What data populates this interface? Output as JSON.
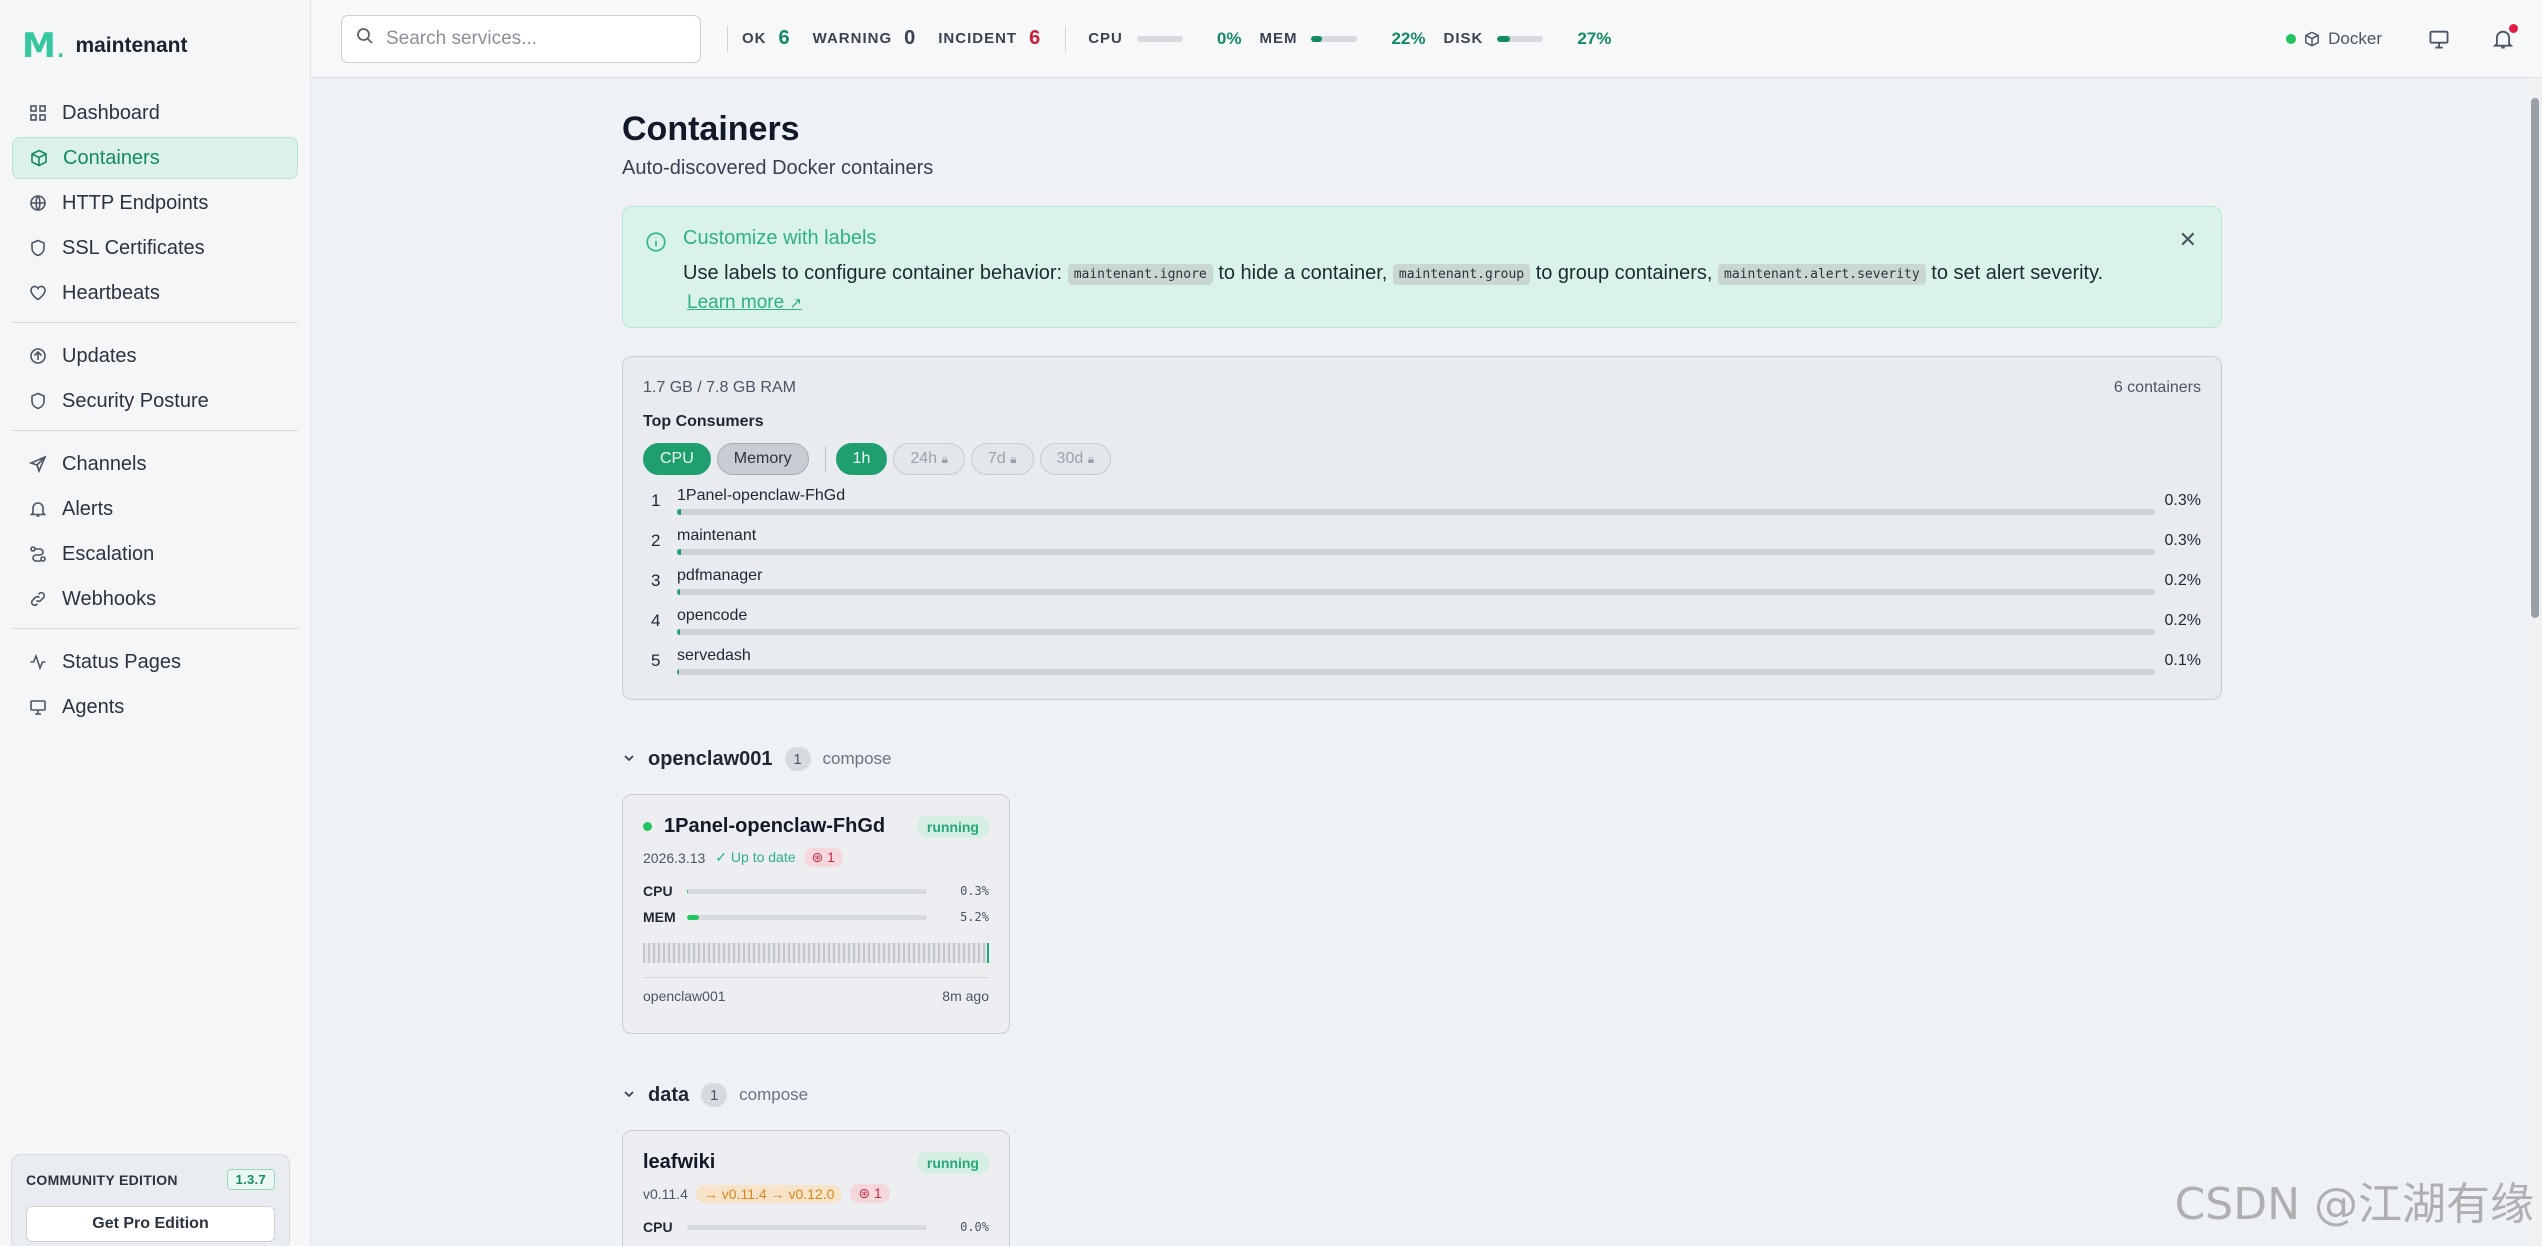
{
  "brand": {
    "name": "maintenant",
    "logo": "M"
  },
  "sidebar": {
    "groups": [
      [
        {
          "label": "Dashboard",
          "icon": "grid-icon"
        },
        {
          "label": "Containers",
          "icon": "box-icon",
          "active": true
        },
        {
          "label": "HTTP Endpoints",
          "icon": "globe-icon"
        },
        {
          "label": "SSL Certificates",
          "icon": "shield-icon"
        },
        {
          "label": "Heartbeats",
          "icon": "heart-icon"
        }
      ],
      [
        {
          "label": "Updates",
          "icon": "arrow-up-circle-icon"
        },
        {
          "label": "Security Posture",
          "icon": "shield-check-icon"
        }
      ],
      [
        {
          "label": "Channels",
          "icon": "send-icon"
        },
        {
          "label": "Alerts",
          "icon": "bell-icon"
        },
        {
          "label": "Escalation",
          "icon": "route-icon"
        },
        {
          "label": "Webhooks",
          "icon": "link-icon"
        }
      ],
      [
        {
          "label": "Status Pages",
          "icon": "activity-icon"
        },
        {
          "label": "Agents",
          "icon": "monitor-icon"
        }
      ]
    ],
    "edition": {
      "label": "COMMUNITY EDITION",
      "version": "1.3.7",
      "button": "Get Pro Edition"
    }
  },
  "topbar": {
    "search_placeholder": "Search services...",
    "ok_label": "OK",
    "ok_count": "6",
    "warning_label": "WARNING",
    "warning_count": "0",
    "incident_label": "INCIDENT",
    "incident_count": "6",
    "cpu_label": "CPU",
    "cpu_pct": "0%",
    "cpu_value": 0,
    "mem_label": "MEM",
    "mem_pct": "22%",
    "mem_value": 22,
    "disk_label": "DISK",
    "disk_pct": "27%",
    "disk_value": 27,
    "runtime": "Docker"
  },
  "page": {
    "title": "Containers",
    "subtitle": "Auto-discovered Docker containers"
  },
  "callout": {
    "title": "Customize with labels",
    "text_1": "Use labels to configure container behavior:",
    "code_1": "maintenant.ignore",
    "text_2": "to hide a container,",
    "code_2": "maintenant.group",
    "text_3": "to group containers,",
    "code_3": "maintenant.alert.severity",
    "text_4": "to set alert severity.",
    "link": "Learn more"
  },
  "consumers": {
    "ram": "1.7 GB / 7.8 GB RAM",
    "count": "6 containers",
    "title": "Top Consumers",
    "metric_tabs": [
      "CPU",
      "Memory"
    ],
    "range_tabs": [
      "1h",
      "24h",
      "7d",
      "30d"
    ],
    "rows": [
      {
        "rank": "1",
        "name": "1Panel-openclaw-FhGd",
        "value": "0.3%",
        "pct": 0.3
      },
      {
        "rank": "2",
        "name": "maintenant",
        "value": "0.3%",
        "pct": 0.3
      },
      {
        "rank": "3",
        "name": "pdfmanager",
        "value": "0.2%",
        "pct": 0.2
      },
      {
        "rank": "4",
        "name": "opencode",
        "value": "0.2%",
        "pct": 0.2
      },
      {
        "rank": "5",
        "name": "servedash",
        "value": "0.1%",
        "pct": 0.1
      }
    ]
  },
  "groups": [
    {
      "name": "openclaw001",
      "count": "1",
      "type": "compose",
      "card": {
        "name": "1Panel-openclaw-FhGd",
        "status": "running",
        "version": "2026.3.13",
        "uptodate": "✓ Up to date",
        "vulns": "1",
        "cpu_label": "CPU",
        "cpu": "0.3%",
        "cpu_value": 0.3,
        "mem_label": "MEM",
        "mem": "5.2%",
        "mem_value": 5.2,
        "footer_left": "openclaw001",
        "footer_right": "8m ago"
      }
    },
    {
      "name": "data",
      "count": "1",
      "type": "compose",
      "card": {
        "name": "leafwiki",
        "status": "running",
        "version": "v0.11.4",
        "update": "→ v0.11.4 → v0.12.0",
        "vulns": "1",
        "cpu_label": "CPU",
        "cpu": "0.0%"
      }
    }
  ],
  "watermark": "CSDN @江湖有缘"
}
